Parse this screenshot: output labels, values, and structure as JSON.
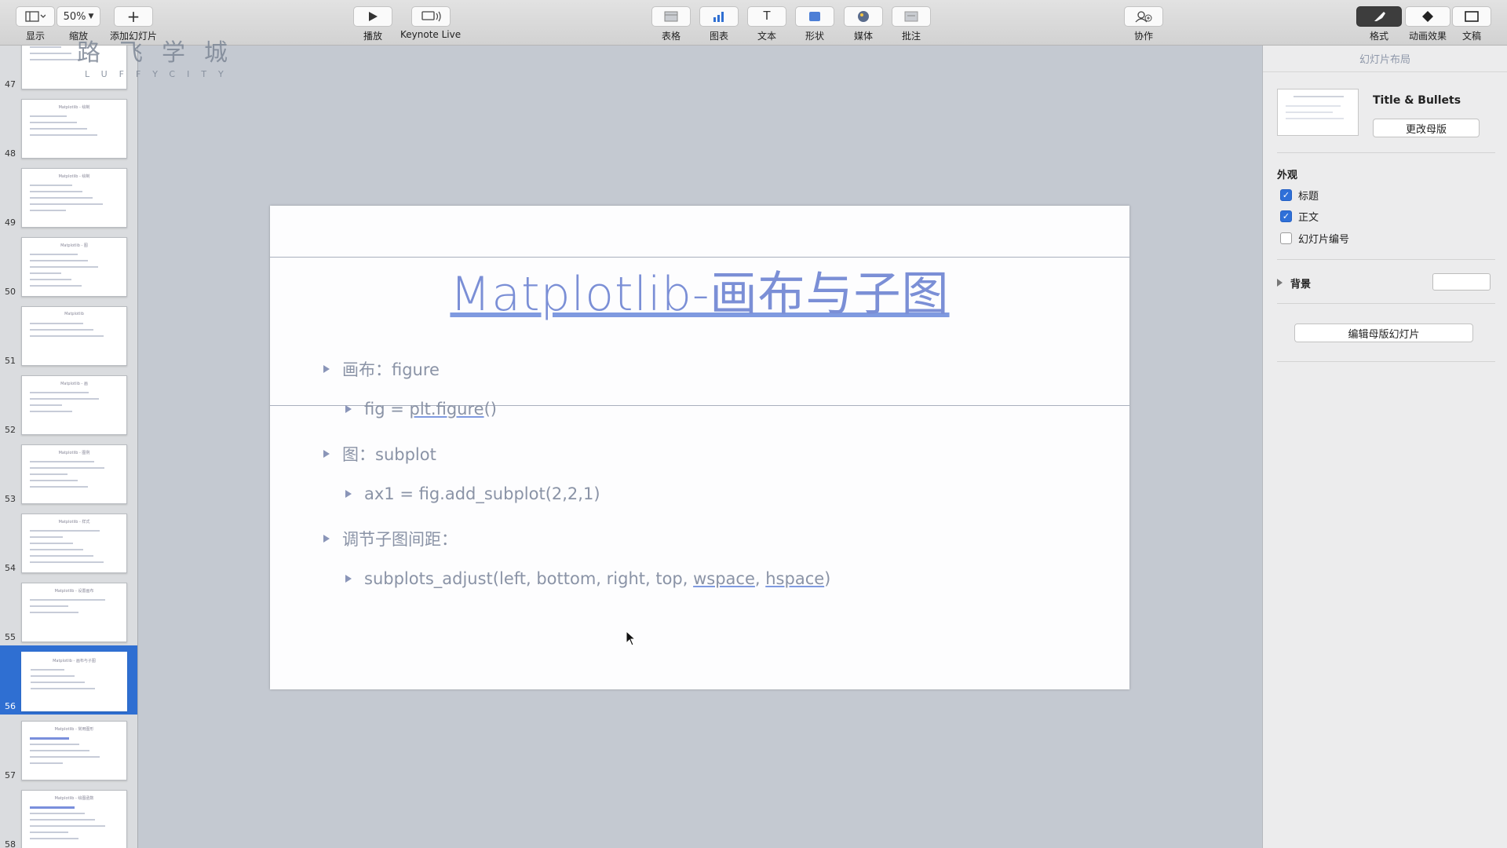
{
  "toolbar": {
    "view_label": "显示",
    "zoom_value": "50%",
    "zoom_label": "缩放",
    "add_slide_label": "添加幻灯片",
    "play_label": "播放",
    "keynote_live_label": "Keynote Live",
    "table_label": "表格",
    "chart_label": "图表",
    "text_label": "文本",
    "shape_label": "形状",
    "media_label": "媒体",
    "comment_label": "批注",
    "collaborate_label": "协作",
    "format_label": "格式",
    "animate_label": "动画效果",
    "document_label": "文稿"
  },
  "watermark": {
    "main": "路飞学城",
    "sub": "LUFFYCITY"
  },
  "navigator": {
    "slides": [
      {
        "number": "47",
        "title": ""
      },
      {
        "number": "48",
        "title": "Matplotlib - 绘制"
      },
      {
        "number": "49",
        "title": "Matplotlib - 绘制"
      },
      {
        "number": "50",
        "title": "Matplotlib - 图"
      },
      {
        "number": "51",
        "title": "Matplotlib"
      },
      {
        "number": "52",
        "title": "Matplotlib - 画"
      },
      {
        "number": "53",
        "title": "Matplotlib - 图例"
      },
      {
        "number": "54",
        "title": "Matplotlib - 样式"
      },
      {
        "number": "55",
        "title": "Matplotlib - 设置画布"
      },
      {
        "number": "56",
        "title": "Matplotlib - 画布与子图"
      },
      {
        "number": "57",
        "title": "Matplotlib - 常用图形"
      },
      {
        "number": "58",
        "title": "Matplotlib - 绘图函数"
      }
    ],
    "selected_index": 9
  },
  "slide": {
    "title": "Matplotlib-画布与子图",
    "bullets": {
      "b1": "画布：figure",
      "b1_sub_code_prefix": "fig = ",
      "b1_sub_code_link": "plt.figure",
      "b1_sub_code_suffix": "()",
      "b2": "图：subplot",
      "b2_sub": "ax1 = fig.add_subplot(2,2,1)",
      "b3": "调节子图间距：",
      "b3_sub_prefix": "subplots_adjust(left, bottom, right, top, ",
      "b3_sub_wspace": "wspace",
      "b3_sub_sep": ", ",
      "b3_sub_hspace": "hspace",
      "b3_sub_suffix": ")"
    }
  },
  "inspector": {
    "header": "幻灯片布局",
    "layout_name": "Title & Bullets",
    "change_master": "更改母版",
    "appearance": "外观",
    "title_checkbox": "标题",
    "title_checked": true,
    "body_checkbox": "正文",
    "body_checked": true,
    "slide_number_checkbox": "幻灯片编号",
    "slide_number_checked": false,
    "background": "背景",
    "edit_master": "编辑母版幻灯片"
  },
  "colors": {
    "accent": "#2f6fd2",
    "slide_title": "#7b8fd6",
    "bullet_text": "#8a93a6"
  }
}
